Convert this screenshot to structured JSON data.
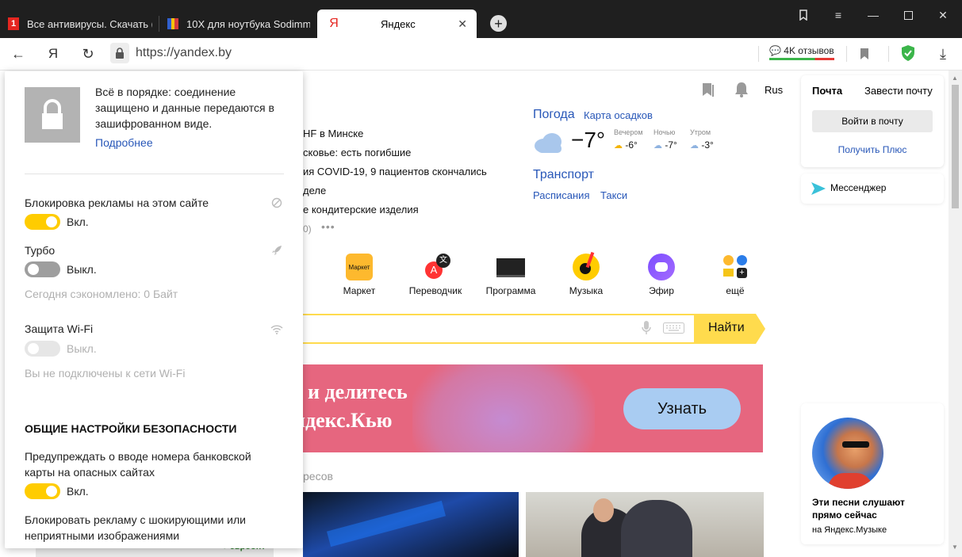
{
  "tabs": [
    {
      "title": "Все антивирусы. Скачать (",
      "favicon": "antivirus-icon"
    },
    {
      "title": "10X для ноутбука Sodimm",
      "favicon": "shop-icon"
    },
    {
      "title": "Яндекс",
      "favicon": "yandex-icon"
    }
  ],
  "tab_new": "+",
  "toolbar": {
    "url": "https://yandex.by",
    "reviews": "4K отзывов",
    "yandex_glyph": "Я"
  },
  "popup": {
    "secure_text": "Всё в порядке: соединение защищено и данные передаются в зашифрованном виде.",
    "more_link": "Подробнее",
    "adblock_label": "Блокировка рекламы на этом сайте",
    "adblock_state": "Вкл.",
    "turbo_label": "Турбо",
    "turbo_state": "Выкл.",
    "turbo_saved": "Сегодня сэкономлено: 0 Байт",
    "wifi_label": "Защита Wi-Fi",
    "wifi_state": "Выкл.",
    "wifi_note": "Вы не подключены к сети Wi-Fi",
    "general_heading": "ОБЩИЕ НАСТРОЙКИ БЕЗОПАСНОСТИ",
    "card_warn_label": "Предупреждать о вводе номера банковской карты на опасных сайтах",
    "card_warn_state": "Вкл.",
    "shock_label": "Блокировать рекламу с шокирующими или неприятными изображениями"
  },
  "news": [
    "HF в Минске",
    "сковье: есть погибшие",
    "ия COVID-19, 9 пациентов скончались",
    "деле",
    "е кондитерские изделия"
  ],
  "news_more": "0)",
  "weather": {
    "title": "Погода",
    "map_link": "Карта осадков",
    "temp": "−7°",
    "periods": [
      {
        "label": "Вечером",
        "temp": "-6°"
      },
      {
        "label": "Ночью",
        "temp": "-7°"
      },
      {
        "label": "Утром",
        "temp": "-3°"
      }
    ]
  },
  "transport": {
    "title": "Транспорт",
    "links": [
      "Расписания",
      "Такси"
    ]
  },
  "services": [
    {
      "label": "Маркет",
      "icon": "market-icon",
      "badge": "Маркет"
    },
    {
      "label": "Переводчик",
      "icon": "translate-icon"
    },
    {
      "label": "Программа",
      "icon": "tv-icon"
    },
    {
      "label": "Музыка",
      "icon": "music-icon"
    },
    {
      "label": "Эфир",
      "icon": "efir-icon"
    },
    {
      "label": "ещё",
      "icon": "more-apps-icon"
    }
  ],
  "search": {
    "button": "Найти"
  },
  "banner": {
    "line1": "е и делитесь",
    "line2": "ндекс.Кью",
    "button": "Узнать"
  },
  "interests_fragment": "ресов",
  "header": {
    "lang": "Rus"
  },
  "mail": {
    "title": "Почта",
    "create": "Завести почту",
    "login": "Войти в почту",
    "plus": "Получить Плюс"
  },
  "messenger": {
    "label": "Мессенджер"
  },
  "music_card": {
    "line1": "Эти песни слушают",
    "line2": "прямо сейчас",
    "sub": "на Яндекс.Музыке"
  },
  "colors": {
    "accent": "#ffdb4d",
    "link": "#2857b8",
    "toggle_on": "#ffcc00",
    "banner": "#e6667f"
  }
}
